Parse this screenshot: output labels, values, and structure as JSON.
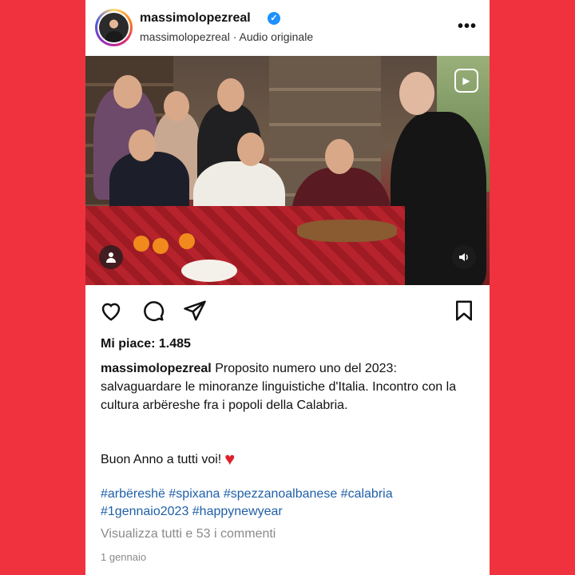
{
  "post": {
    "username": "massimolopezreal",
    "subline": "massimolopezreal · Audio originale",
    "likes": "Mi piace: 1.485",
    "caption_user": "massimolopezreal",
    "caption_text": "Proposito numero uno del 2023: salvaguardare le minoranze linguistiche d'Italia. Incontro con la cultura arbëreshe fra i popoli della Calabria.",
    "greeting": "Buon Anno a tutti voi!",
    "hashtags": "#arbëreshë #spixana #spezzanoalbanese #calabria #1gennaio2023 #happynewyear",
    "comments_link": "Visualizza tutti e 53 i commenti",
    "date": "1 gennaio"
  },
  "icons": {
    "more": "more-options-icon",
    "verified": "verified-badge-icon",
    "like": "heart-icon",
    "comment": "comment-icon",
    "share": "share-icon",
    "save": "bookmark-icon",
    "reel": "reel-icon",
    "tag": "tagged-user-icon",
    "sound": "sound-icon"
  },
  "colors": {
    "background": "#f0323f",
    "hashtag": "#1f5fa8",
    "verified": "#1e90ff",
    "heart": "#e0202a"
  }
}
